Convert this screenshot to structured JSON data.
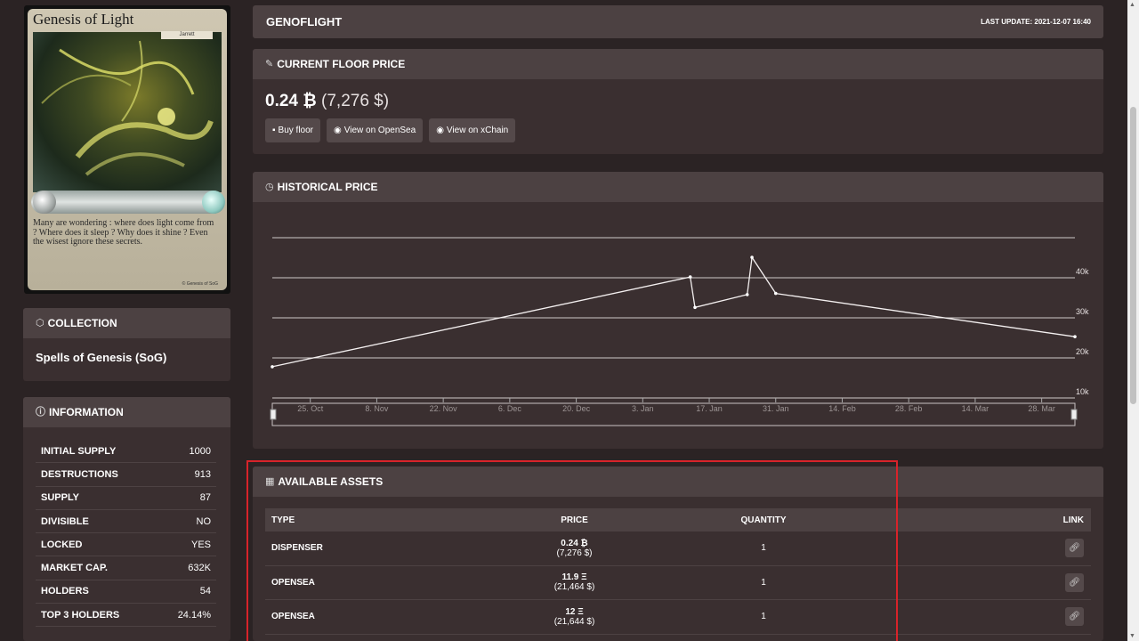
{
  "card": {
    "title": "Genesis of Light",
    "tag": "Jarrett",
    "flavor": "Many are wondering : where does light come from ? Where does it sleep ? Why does it shine ? Even the wisest ignore these secrets.",
    "copyright": "© Genesis of SoG"
  },
  "collection": {
    "heading": "COLLECTION",
    "name": "Spells of Genesis (SoG)"
  },
  "information": {
    "heading": "INFORMATION",
    "rows": [
      {
        "label": "INITIAL SUPPLY",
        "value": "1000"
      },
      {
        "label": "DESTRUCTIONS",
        "value": "913"
      },
      {
        "label": "SUPPLY",
        "value": "87"
      },
      {
        "label": "DIVISIBLE",
        "value": "NO"
      },
      {
        "label": "LOCKED",
        "value": "YES"
      },
      {
        "label": "MARKET CAP.",
        "value": "632K"
      },
      {
        "label": "HOLDERS",
        "value": "54"
      },
      {
        "label": "TOP 3 HOLDERS",
        "value": "24.14%"
      }
    ]
  },
  "header": {
    "title": "GENOFLIGHT",
    "last_update": "LAST UPDATE: 2021-12-07 16:40"
  },
  "floor": {
    "heading": "CURRENT FLOOR PRICE",
    "price": "0.24 ₿",
    "usd": "(7,276 $)",
    "buttons": {
      "buy": "Buy floor",
      "opensea": "View on OpenSea",
      "xchain": "View on xChain"
    }
  },
  "history": {
    "heading": "HISTORICAL PRICE"
  },
  "chart_data": {
    "type": "line",
    "title": "",
    "x_ticks": [
      "25. Oct",
      "8. Nov",
      "22. Nov",
      "6. Dec",
      "20. Dec",
      "3. Jan",
      "17. Jan",
      "31. Jan",
      "14. Feb",
      "28. Feb",
      "14. Mar",
      "28. Mar"
    ],
    "y_ticks": [
      "10k",
      "20k",
      "30k",
      "40k"
    ],
    "ylim": [
      10000,
      50000
    ],
    "series": [
      {
        "points": [
          {
            "x": "2021-10-17",
            "y": 17800
          },
          {
            "x": "2022-01-13",
            "y": 40200
          },
          {
            "x": "2022-01-14",
            "y": 32600
          },
          {
            "x": "2022-01-25",
            "y": 35800
          },
          {
            "x": "2022-01-26",
            "y": 45100
          },
          {
            "x": "2022-01-31",
            "y": 36100
          },
          {
            "x": "2022-04-04",
            "y": 25300
          }
        ]
      }
    ],
    "grid": true
  },
  "assets": {
    "heading": "AVAILABLE ASSETS",
    "columns": {
      "type": "TYPE",
      "price": "PRICE",
      "quantity": "QUANTITY",
      "link": "LINK"
    },
    "rows": [
      {
        "type": "DISPENSER",
        "price": "0.24 ₿",
        "usd": "(7,276 $)",
        "quantity": "1"
      },
      {
        "type": "OPENSEA",
        "price": "11.9 Ξ",
        "usd": "(21,464 $)",
        "quantity": "1"
      },
      {
        "type": "OPENSEA",
        "price": "12 Ξ",
        "usd": "(21,644 $)",
        "quantity": "1"
      }
    ]
  }
}
